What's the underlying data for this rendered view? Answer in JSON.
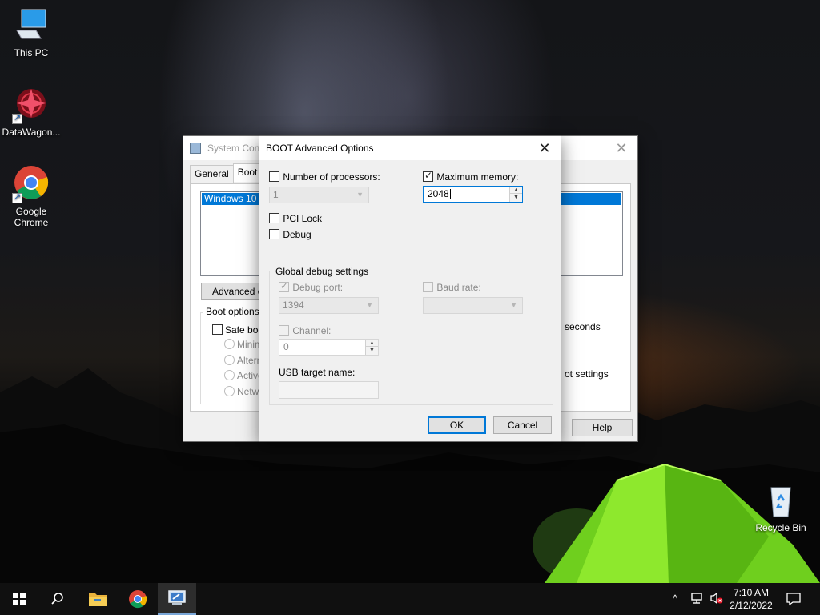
{
  "desktop": {
    "icons": [
      {
        "label": "This PC",
        "icon": "computer-icon"
      },
      {
        "label": "DataWagon...",
        "icon": "datawagon-logo-icon"
      },
      {
        "label": "Google Chrome",
        "icon": "chrome-icon"
      },
      {
        "label": "Recycle Bin",
        "icon": "recycle-bin-icon"
      }
    ]
  },
  "system_config": {
    "title": "System Conf",
    "tabs": [
      "General",
      "Boot"
    ],
    "active_tab": "Boot",
    "os_entry": "Windows 10 (C",
    "advanced_button": "Advanced op",
    "boot_options_label": "Boot options",
    "safe_boot_label": "Safe boo",
    "radio_labels": [
      "Minima",
      "Altern",
      "Active",
      "Netwo"
    ],
    "timeout_unit_fragment": "seconds",
    "boot_settings_fragment": "ot settings",
    "help_button": "Help"
  },
  "boot_advanced": {
    "title": "BOOT Advanced Options",
    "num_processors": {
      "label": "Number of processors:",
      "checked": false,
      "value": "1"
    },
    "max_memory": {
      "label": "Maximum memory:",
      "checked": true,
      "value": "2048"
    },
    "pci_lock": {
      "label": "PCI Lock",
      "checked": false
    },
    "debug": {
      "label": "Debug",
      "checked": false
    },
    "global_debug_label": "Global debug settings",
    "debug_port": {
      "label": "Debug port:",
      "checked": true,
      "value": "1394"
    },
    "baud_rate": {
      "label": "Baud rate:",
      "checked": false,
      "value": ""
    },
    "channel": {
      "label": "Channel:",
      "checked": false,
      "value": "0"
    },
    "usb_target": {
      "label": "USB target name:",
      "value": ""
    },
    "ok_button": "OK",
    "cancel_button": "Cancel"
  },
  "taskbar": {
    "items": [
      "start-icon",
      "search-icon",
      "file-explorer-icon",
      "chrome-icon",
      "msconfig-icon"
    ],
    "active_item": "msconfig-icon",
    "clock_time": "7:10 AM",
    "clock_date": "2/12/2022"
  }
}
